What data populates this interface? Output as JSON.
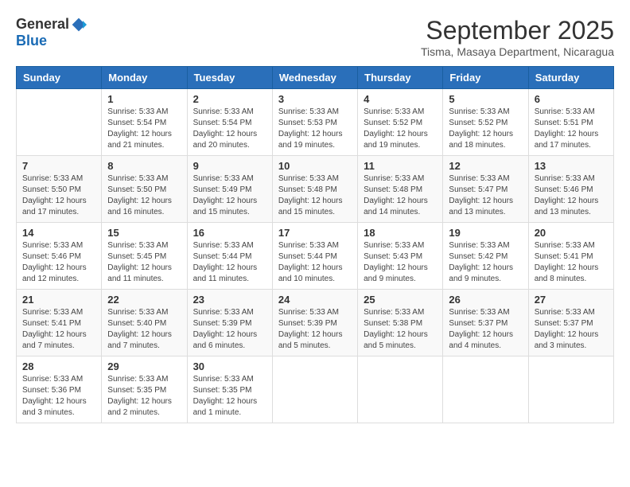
{
  "header": {
    "logo_general": "General",
    "logo_blue": "Blue",
    "month_year": "September 2025",
    "location": "Tisma, Masaya Department, Nicaragua"
  },
  "days_of_week": [
    "Sunday",
    "Monday",
    "Tuesday",
    "Wednesday",
    "Thursday",
    "Friday",
    "Saturday"
  ],
  "weeks": [
    [
      {
        "day": "",
        "sunrise": "",
        "sunset": "",
        "daylight": ""
      },
      {
        "day": "1",
        "sunrise": "Sunrise: 5:33 AM",
        "sunset": "Sunset: 5:54 PM",
        "daylight": "Daylight: 12 hours and 21 minutes."
      },
      {
        "day": "2",
        "sunrise": "Sunrise: 5:33 AM",
        "sunset": "Sunset: 5:54 PM",
        "daylight": "Daylight: 12 hours and 20 minutes."
      },
      {
        "day": "3",
        "sunrise": "Sunrise: 5:33 AM",
        "sunset": "Sunset: 5:53 PM",
        "daylight": "Daylight: 12 hours and 19 minutes."
      },
      {
        "day": "4",
        "sunrise": "Sunrise: 5:33 AM",
        "sunset": "Sunset: 5:52 PM",
        "daylight": "Daylight: 12 hours and 19 minutes."
      },
      {
        "day": "5",
        "sunrise": "Sunrise: 5:33 AM",
        "sunset": "Sunset: 5:52 PM",
        "daylight": "Daylight: 12 hours and 18 minutes."
      },
      {
        "day": "6",
        "sunrise": "Sunrise: 5:33 AM",
        "sunset": "Sunset: 5:51 PM",
        "daylight": "Daylight: 12 hours and 17 minutes."
      }
    ],
    [
      {
        "day": "7",
        "sunrise": "Sunrise: 5:33 AM",
        "sunset": "Sunset: 5:50 PM",
        "daylight": "Daylight: 12 hours and 17 minutes."
      },
      {
        "day": "8",
        "sunrise": "Sunrise: 5:33 AM",
        "sunset": "Sunset: 5:50 PM",
        "daylight": "Daylight: 12 hours and 16 minutes."
      },
      {
        "day": "9",
        "sunrise": "Sunrise: 5:33 AM",
        "sunset": "Sunset: 5:49 PM",
        "daylight": "Daylight: 12 hours and 15 minutes."
      },
      {
        "day": "10",
        "sunrise": "Sunrise: 5:33 AM",
        "sunset": "Sunset: 5:48 PM",
        "daylight": "Daylight: 12 hours and 15 minutes."
      },
      {
        "day": "11",
        "sunrise": "Sunrise: 5:33 AM",
        "sunset": "Sunset: 5:48 PM",
        "daylight": "Daylight: 12 hours and 14 minutes."
      },
      {
        "day": "12",
        "sunrise": "Sunrise: 5:33 AM",
        "sunset": "Sunset: 5:47 PM",
        "daylight": "Daylight: 12 hours and 13 minutes."
      },
      {
        "day": "13",
        "sunrise": "Sunrise: 5:33 AM",
        "sunset": "Sunset: 5:46 PM",
        "daylight": "Daylight: 12 hours and 13 minutes."
      }
    ],
    [
      {
        "day": "14",
        "sunrise": "Sunrise: 5:33 AM",
        "sunset": "Sunset: 5:46 PM",
        "daylight": "Daylight: 12 hours and 12 minutes."
      },
      {
        "day": "15",
        "sunrise": "Sunrise: 5:33 AM",
        "sunset": "Sunset: 5:45 PM",
        "daylight": "Daylight: 12 hours and 11 minutes."
      },
      {
        "day": "16",
        "sunrise": "Sunrise: 5:33 AM",
        "sunset": "Sunset: 5:44 PM",
        "daylight": "Daylight: 12 hours and 11 minutes."
      },
      {
        "day": "17",
        "sunrise": "Sunrise: 5:33 AM",
        "sunset": "Sunset: 5:44 PM",
        "daylight": "Daylight: 12 hours and 10 minutes."
      },
      {
        "day": "18",
        "sunrise": "Sunrise: 5:33 AM",
        "sunset": "Sunset: 5:43 PM",
        "daylight": "Daylight: 12 hours and 9 minutes."
      },
      {
        "day": "19",
        "sunrise": "Sunrise: 5:33 AM",
        "sunset": "Sunset: 5:42 PM",
        "daylight": "Daylight: 12 hours and 9 minutes."
      },
      {
        "day": "20",
        "sunrise": "Sunrise: 5:33 AM",
        "sunset": "Sunset: 5:41 PM",
        "daylight": "Daylight: 12 hours and 8 minutes."
      }
    ],
    [
      {
        "day": "21",
        "sunrise": "Sunrise: 5:33 AM",
        "sunset": "Sunset: 5:41 PM",
        "daylight": "Daylight: 12 hours and 7 minutes."
      },
      {
        "day": "22",
        "sunrise": "Sunrise: 5:33 AM",
        "sunset": "Sunset: 5:40 PM",
        "daylight": "Daylight: 12 hours and 7 minutes."
      },
      {
        "day": "23",
        "sunrise": "Sunrise: 5:33 AM",
        "sunset": "Sunset: 5:39 PM",
        "daylight": "Daylight: 12 hours and 6 minutes."
      },
      {
        "day": "24",
        "sunrise": "Sunrise: 5:33 AM",
        "sunset": "Sunset: 5:39 PM",
        "daylight": "Daylight: 12 hours and 5 minutes."
      },
      {
        "day": "25",
        "sunrise": "Sunrise: 5:33 AM",
        "sunset": "Sunset: 5:38 PM",
        "daylight": "Daylight: 12 hours and 5 minutes."
      },
      {
        "day": "26",
        "sunrise": "Sunrise: 5:33 AM",
        "sunset": "Sunset: 5:37 PM",
        "daylight": "Daylight: 12 hours and 4 minutes."
      },
      {
        "day": "27",
        "sunrise": "Sunrise: 5:33 AM",
        "sunset": "Sunset: 5:37 PM",
        "daylight": "Daylight: 12 hours and 3 minutes."
      }
    ],
    [
      {
        "day": "28",
        "sunrise": "Sunrise: 5:33 AM",
        "sunset": "Sunset: 5:36 PM",
        "daylight": "Daylight: 12 hours and 3 minutes."
      },
      {
        "day": "29",
        "sunrise": "Sunrise: 5:33 AM",
        "sunset": "Sunset: 5:35 PM",
        "daylight": "Daylight: 12 hours and 2 minutes."
      },
      {
        "day": "30",
        "sunrise": "Sunrise: 5:33 AM",
        "sunset": "Sunset: 5:35 PM",
        "daylight": "Daylight: 12 hours and 1 minute."
      },
      {
        "day": "",
        "sunrise": "",
        "sunset": "",
        "daylight": ""
      },
      {
        "day": "",
        "sunrise": "",
        "sunset": "",
        "daylight": ""
      },
      {
        "day": "",
        "sunrise": "",
        "sunset": "",
        "daylight": ""
      },
      {
        "day": "",
        "sunrise": "",
        "sunset": "",
        "daylight": ""
      }
    ]
  ]
}
